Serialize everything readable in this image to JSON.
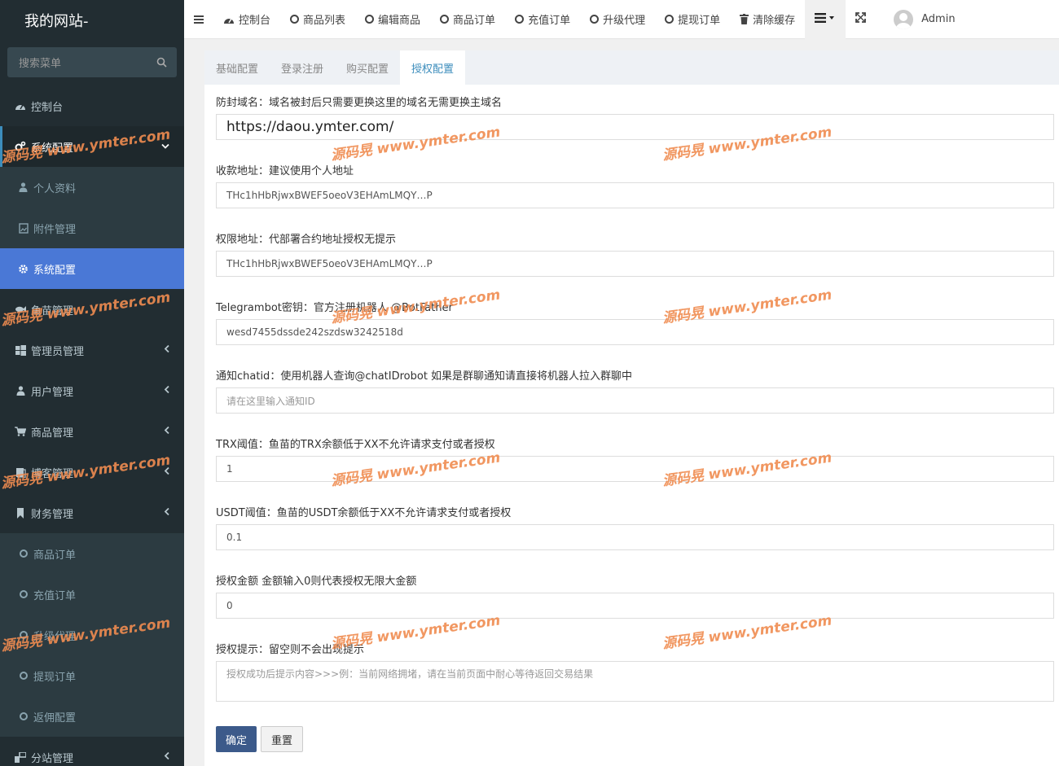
{
  "brand": {
    "title": "我的网站-"
  },
  "search": {
    "placeholder": "搜索菜单"
  },
  "sidebar": {
    "items": [
      {
        "label": "控制台",
        "icon": "dashboard-icon"
      },
      {
        "label": "系统配置",
        "icon": "cogs-icon"
      },
      {
        "label": "鱼苗管理",
        "icon": "fish-icon"
      },
      {
        "label": "管理员管理",
        "icon": "windows-icon"
      },
      {
        "label": "用户管理",
        "icon": "user-icon"
      },
      {
        "label": "商品管理",
        "icon": "cart-icon"
      },
      {
        "label": "博客管理",
        "icon": "blog-icon"
      },
      {
        "label": "财务管理",
        "icon": "bookmark-icon"
      },
      {
        "label": "分站管理",
        "icon": "sitemap-icon"
      }
    ],
    "sub_system": [
      {
        "label": "个人资料",
        "icon": "user-icon"
      },
      {
        "label": "附件管理",
        "icon": "file-image-icon"
      },
      {
        "label": "系统配置",
        "icon": "gear-icon"
      }
    ],
    "sub_finance": [
      {
        "label": "商品订单"
      },
      {
        "label": "充值订单"
      },
      {
        "label": "升级代理"
      },
      {
        "label": "提现订单"
      },
      {
        "label": "返佣配置"
      }
    ]
  },
  "topnav": {
    "items": [
      {
        "label": "控制台"
      },
      {
        "label": "商品列表"
      },
      {
        "label": "编辑商品"
      },
      {
        "label": "商品订单"
      },
      {
        "label": "充值订单"
      },
      {
        "label": "升级代理"
      },
      {
        "label": "提现订单"
      },
      {
        "label": "清除缓存"
      }
    ],
    "user": "Admin"
  },
  "tabs": [
    "基础配置",
    "登录注册",
    "购买配置",
    "授权配置"
  ],
  "form": {
    "fields": [
      {
        "label": "防封域名：域名被封后只需要更换这里的域名无需更换主域名",
        "value": "https://daou.ymter.com/"
      },
      {
        "label": "收款地址：建议使用个人地址",
        "value": "THc1hHbRjwxBWEF5oeoV3EHAmLMQY…P"
      },
      {
        "label": "权限地址：代部署合约地址授权无提示",
        "value": "THc1hHbRjwxBWEF5oeoV3EHAmLMQY…P"
      },
      {
        "label": "Telegrambot密钥：官方注册机器人 @BotFather",
        "value": "wesd7455dssde242szdsw3242518d"
      },
      {
        "label": "通知chatid：使用机器人查询@chatIDrobot 如果是群聊通知请直接将机器人拉入群聊中",
        "placeholder": "请在这里输入通知ID"
      },
      {
        "label": "TRX阈值：鱼苗的TRX余额低于XX不允许请求支付或者授权",
        "value": "1"
      },
      {
        "label": "USDT阈值：鱼苗的USDT余额低于XX不允许请求支付或者授权",
        "value": "0.1"
      },
      {
        "label": "授权金额 金额输入0则代表授权无限大金额",
        "value": "0"
      },
      {
        "label": "授权提示：留空则不会出现提示",
        "placeholder": "授权成功后提示内容>>>例：当前网络拥堵，请在当前页面中耐心等待返回交易结果"
      }
    ],
    "submit_label": "确定",
    "reset_label": "重置"
  },
  "watermark": {
    "text": "源码晃  www.ymter.com",
    "color": "#f08c50"
  },
  "colors": {
    "sidebar_bg": "#222d32",
    "active": "#4a78d6",
    "accent": "#3c8dbc",
    "submit": "#3c5a8a"
  }
}
